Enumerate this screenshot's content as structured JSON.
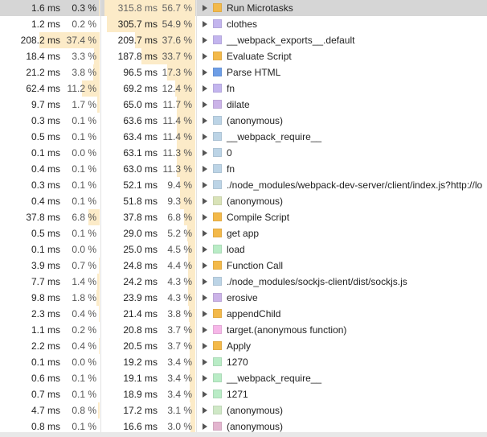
{
  "rows": [
    {
      "self_time": "1.6 ms",
      "self_pct": "0.3 %",
      "self_frac": 0.003,
      "total_time": "315.8 ms",
      "total_pct": "56.7 %",
      "total_frac": 0.567,
      "color": "#f3b94a",
      "name": "Run Microtasks",
      "selected": true
    },
    {
      "self_time": "1.2 ms",
      "self_pct": "0.2 %",
      "self_frac": 0.002,
      "total_time": "305.7 ms",
      "total_pct": "54.9 %",
      "total_frac": 0.549,
      "color": "#c3b5ee",
      "name": "clothes"
    },
    {
      "self_time": "208.2 ms",
      "self_pct": "37.4 %",
      "self_frac": 0.374,
      "total_time": "209.7 ms",
      "total_pct": "37.6 %",
      "total_frac": 0.376,
      "color": "#c3b5ee",
      "name": "__webpack_exports__.default"
    },
    {
      "self_time": "18.4 ms",
      "self_pct": "3.3 %",
      "self_frac": 0.033,
      "total_time": "187.8 ms",
      "total_pct": "33.7 %",
      "total_frac": 0.337,
      "color": "#f3b94a",
      "name": "Evaluate Script"
    },
    {
      "self_time": "21.2 ms",
      "self_pct": "3.8 %",
      "self_frac": 0.038,
      "total_time": "96.5 ms",
      "total_pct": "17.3 %",
      "total_frac": 0.173,
      "color": "#6e9ee6",
      "name": "Parse HTML"
    },
    {
      "self_time": "62.4 ms",
      "self_pct": "11.2 %",
      "self_frac": 0.112,
      "total_time": "69.2 ms",
      "total_pct": "12.4 %",
      "total_frac": 0.124,
      "color": "#c3b5ee",
      "name": "fn"
    },
    {
      "self_time": "9.7 ms",
      "self_pct": "1.7 %",
      "self_frac": 0.017,
      "total_time": "65.0 ms",
      "total_pct": "11.7 %",
      "total_frac": 0.117,
      "color": "#cbb3e8",
      "name": "dilate"
    },
    {
      "self_time": "0.3 ms",
      "self_pct": "0.1 %",
      "self_frac": 0.001,
      "total_time": "63.6 ms",
      "total_pct": "11.4 %",
      "total_frac": 0.114,
      "color": "#bcd4e6",
      "name": "(anonymous)"
    },
    {
      "self_time": "0.5 ms",
      "self_pct": "0.1 %",
      "self_frac": 0.001,
      "total_time": "63.4 ms",
      "total_pct": "11.4 %",
      "total_frac": 0.114,
      "color": "#bcd4e6",
      "name": "__webpack_require__"
    },
    {
      "self_time": "0.1 ms",
      "self_pct": "0.0 %",
      "self_frac": 0.0,
      "total_time": "63.1 ms",
      "total_pct": "11.3 %",
      "total_frac": 0.113,
      "color": "#bcd4e6",
      "name": "0"
    },
    {
      "self_time": "0.4 ms",
      "self_pct": "0.1 %",
      "self_frac": 0.001,
      "total_time": "63.0 ms",
      "total_pct": "11.3 %",
      "total_frac": 0.113,
      "color": "#bcd4e6",
      "name": "fn"
    },
    {
      "self_time": "0.3 ms",
      "self_pct": "0.1 %",
      "self_frac": 0.001,
      "total_time": "52.1 ms",
      "total_pct": "9.4 %",
      "total_frac": 0.094,
      "color": "#bcd4e6",
      "name": "./node_modules/webpack-dev-server/client/index.js?http://lo"
    },
    {
      "self_time": "0.4 ms",
      "self_pct": "0.1 %",
      "self_frac": 0.001,
      "total_time": "51.8 ms",
      "total_pct": "9.3 %",
      "total_frac": 0.093,
      "color": "#d9e3b8",
      "name": "(anonymous)"
    },
    {
      "self_time": "37.8 ms",
      "self_pct": "6.8 %",
      "self_frac": 0.068,
      "total_time": "37.8 ms",
      "total_pct": "6.8 %",
      "total_frac": 0.068,
      "color": "#f3b94a",
      "name": "Compile Script"
    },
    {
      "self_time": "0.5 ms",
      "self_pct": "0.1 %",
      "self_frac": 0.001,
      "total_time": "29.0 ms",
      "total_pct": "5.2 %",
      "total_frac": 0.052,
      "color": "#f3b94a",
      "name": "get app"
    },
    {
      "self_time": "0.1 ms",
      "self_pct": "0.0 %",
      "self_frac": 0.0,
      "total_time": "25.0 ms",
      "total_pct": "4.5 %",
      "total_frac": 0.045,
      "color": "#b9ecc6",
      "name": "load"
    },
    {
      "self_time": "3.9 ms",
      "self_pct": "0.7 %",
      "self_frac": 0.007,
      "total_time": "24.8 ms",
      "total_pct": "4.4 %",
      "total_frac": 0.044,
      "color": "#f3b94a",
      "name": "Function Call"
    },
    {
      "self_time": "7.7 ms",
      "self_pct": "1.4 %",
      "self_frac": 0.014,
      "total_time": "24.2 ms",
      "total_pct": "4.3 %",
      "total_frac": 0.043,
      "color": "#bcd4e6",
      "name": "./node_modules/sockjs-client/dist/sockjs.js"
    },
    {
      "self_time": "9.8 ms",
      "self_pct": "1.8 %",
      "self_frac": 0.018,
      "total_time": "23.9 ms",
      "total_pct": "4.3 %",
      "total_frac": 0.043,
      "color": "#cbb3e8",
      "name": "erosive"
    },
    {
      "self_time": "2.3 ms",
      "self_pct": "0.4 %",
      "self_frac": 0.004,
      "total_time": "21.4 ms",
      "total_pct": "3.8 %",
      "total_frac": 0.038,
      "color": "#f3b94a",
      "name": "appendChild"
    },
    {
      "self_time": "1.1 ms",
      "self_pct": "0.2 %",
      "self_frac": 0.002,
      "total_time": "20.8 ms",
      "total_pct": "3.7 %",
      "total_frac": 0.037,
      "color": "#f6b7e8",
      "name": "target.(anonymous function)"
    },
    {
      "self_time": "2.2 ms",
      "self_pct": "0.4 %",
      "self_frac": 0.004,
      "total_time": "20.5 ms",
      "total_pct": "3.7 %",
      "total_frac": 0.037,
      "color": "#f3b94a",
      "name": "Apply"
    },
    {
      "self_time": "0.1 ms",
      "self_pct": "0.0 %",
      "self_frac": 0.0,
      "total_time": "19.2 ms",
      "total_pct": "3.4 %",
      "total_frac": 0.034,
      "color": "#b9ecc6",
      "name": "1270"
    },
    {
      "self_time": "0.6 ms",
      "self_pct": "0.1 %",
      "self_frac": 0.001,
      "total_time": "19.1 ms",
      "total_pct": "3.4 %",
      "total_frac": 0.034,
      "color": "#b9ecc6",
      "name": "__webpack_require__"
    },
    {
      "self_time": "0.7 ms",
      "self_pct": "0.1 %",
      "self_frac": 0.001,
      "total_time": "18.9 ms",
      "total_pct": "3.4 %",
      "total_frac": 0.034,
      "color": "#b9ecc6",
      "name": "1271"
    },
    {
      "self_time": "4.7 ms",
      "self_pct": "0.8 %",
      "self_frac": 0.008,
      "total_time": "17.2 ms",
      "total_pct": "3.1 %",
      "total_frac": 0.031,
      "color": "#cfe8c6",
      "name": "(anonymous)"
    },
    {
      "self_time": "0.8 ms",
      "self_pct": "0.1 %",
      "self_frac": 0.001,
      "total_time": "16.6 ms",
      "total_pct": "3.0 %",
      "total_frac": 0.03,
      "color": "#e3b5cf",
      "name": "(anonymous)"
    }
  ]
}
